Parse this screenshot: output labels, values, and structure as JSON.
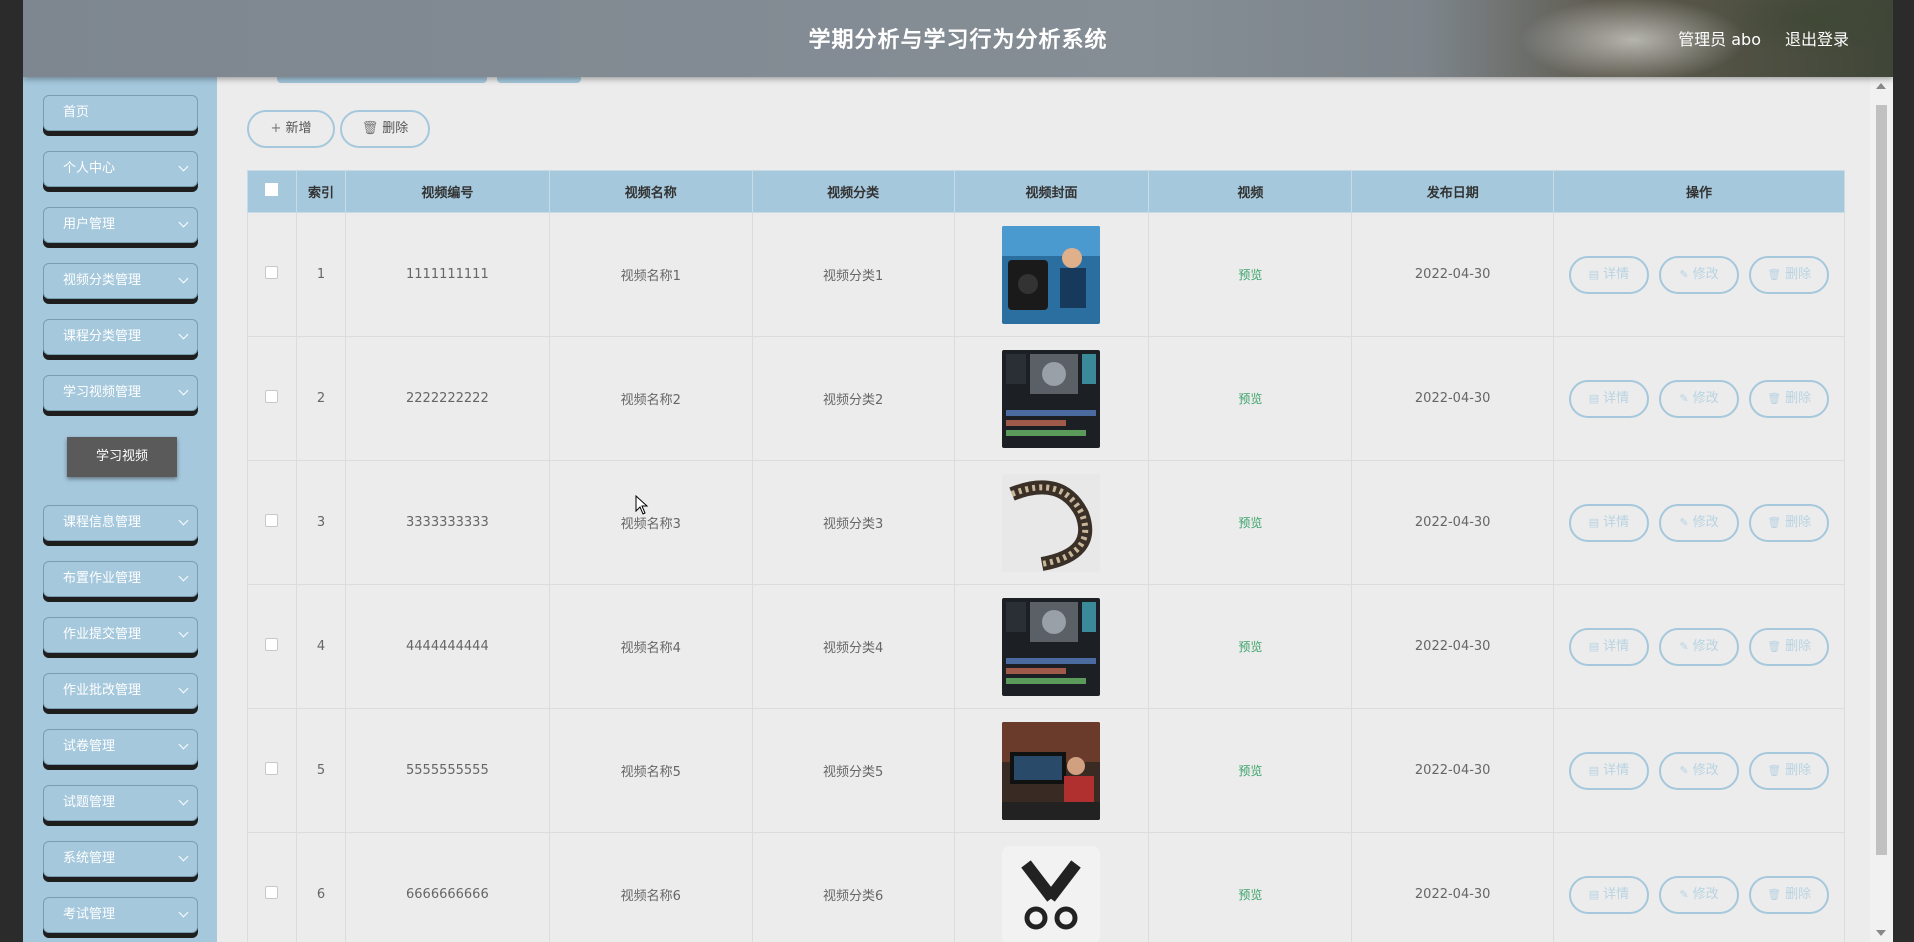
{
  "header": {
    "title": "学期分析与学习行为分析系统",
    "user": "管理员 abo",
    "logout": "退出登录"
  },
  "sidebar": {
    "items": [
      {
        "label": "首页",
        "has_children": false
      },
      {
        "label": "个人中心",
        "has_children": true
      },
      {
        "label": "用户管理",
        "has_children": true
      },
      {
        "label": "视频分类管理",
        "has_children": true
      },
      {
        "label": "课程分类管理",
        "has_children": true
      },
      {
        "label": "学习视频管理",
        "has_children": true
      },
      {
        "label": "课程信息管理",
        "has_children": true
      },
      {
        "label": "布置作业管理",
        "has_children": true
      },
      {
        "label": "作业提交管理",
        "has_children": true
      },
      {
        "label": "作业批改管理",
        "has_children": true
      },
      {
        "label": "试卷管理",
        "has_children": true
      },
      {
        "label": "试题管理",
        "has_children": true
      },
      {
        "label": "系统管理",
        "has_children": true
      },
      {
        "label": "考试管理",
        "has_children": true
      }
    ],
    "active_sub": "学习视频"
  },
  "toolbar": {
    "add_label": "新增",
    "delete_label": "删除"
  },
  "table": {
    "headers": [
      "索引",
      "视频编号",
      "视频名称",
      "视频分类",
      "视频封面",
      "视频",
      "发布日期",
      "操作"
    ],
    "rows": [
      {
        "index": "1",
        "code": "1111111111",
        "name": "视频名称1",
        "category": "视频分类1",
        "video": "预览",
        "date": "2022-04-30",
        "cover": "camera-crew"
      },
      {
        "index": "2",
        "code": "2222222222",
        "name": "视频名称2",
        "category": "视频分类2",
        "video": "预览",
        "date": "2022-04-30",
        "cover": "editing-software"
      },
      {
        "index": "3",
        "code": "3333333333",
        "name": "视频名称3",
        "category": "视频分类3",
        "video": "预览",
        "date": "2022-04-30",
        "cover": "film-reel"
      },
      {
        "index": "4",
        "code": "4444444444",
        "name": "视频名称4",
        "category": "视频分类4",
        "video": "预览",
        "date": "2022-04-30",
        "cover": "editing-software"
      },
      {
        "index": "5",
        "code": "5555555555",
        "name": "视频名称5",
        "category": "视频分类5",
        "video": "预览",
        "date": "2022-04-30",
        "cover": "editor-desk"
      },
      {
        "index": "6",
        "code": "6666666666",
        "name": "视频名称6",
        "category": "视频分类6",
        "video": "预览",
        "date": "2022-04-30",
        "cover": "film-scissors-icon"
      }
    ],
    "actions": {
      "detail": "详情",
      "edit": "修改",
      "delete": "删除"
    }
  },
  "colors": {
    "accent": "#a5c8dc",
    "preview_green": "#3aa36a",
    "sub_active_bg": "#5a5a5a"
  }
}
